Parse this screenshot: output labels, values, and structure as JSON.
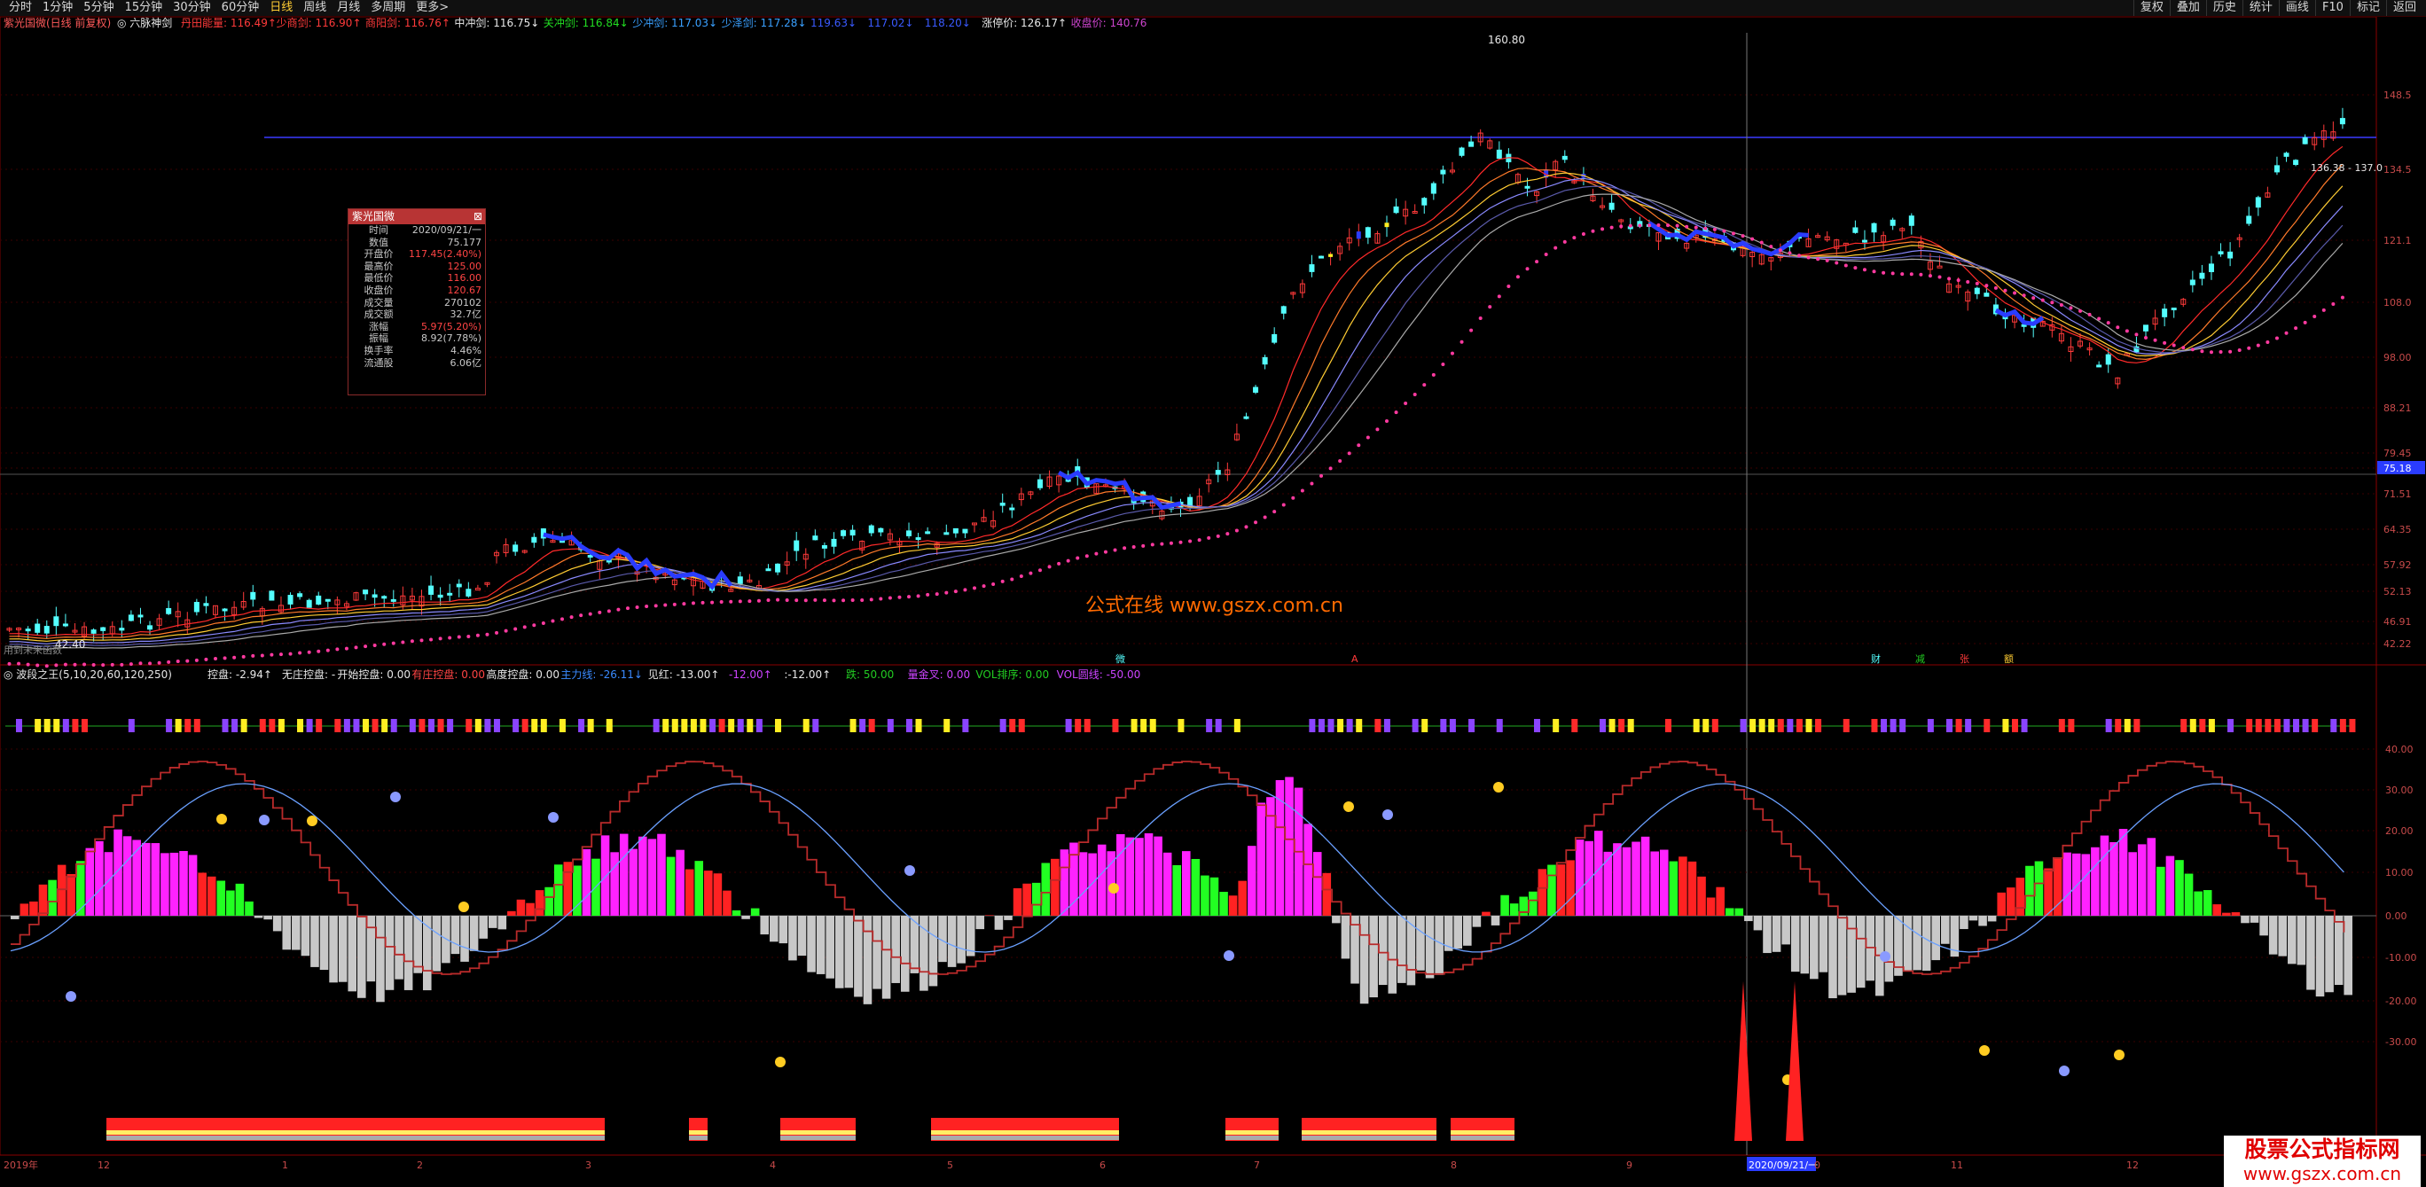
{
  "toolbar": {
    "periods": [
      "分时",
      "1分钟",
      "5分钟",
      "15分钟",
      "30分钟",
      "60分钟",
      "日线",
      "周线",
      "月线",
      "多周期",
      "更多>"
    ],
    "active_period": "日线",
    "right_buttons": [
      "复权",
      "叠加",
      "历史",
      "统计",
      "画线",
      "F10",
      "标记",
      "返回"
    ]
  },
  "main_header": {
    "stock": "紫光国微(日线 前复权)",
    "indicator": "◎ 六脉神剑",
    "items": [
      {
        "label": "丹田能量: 116.49↑",
        "color": "#ff3a3a"
      },
      {
        "label": "少商剑: 116.90↑",
        "color": "#ff3a3a"
      },
      {
        "label": "商阳剑: 116.76↑",
        "color": "#ff3a3a"
      },
      {
        "label": "中冲剑: 116.75↓",
        "color": "#e8e8e8"
      },
      {
        "label": "关冲剑: 116.84↓",
        "color": "#22dd22"
      },
      {
        "label": "少冲剑: 117.03↓",
        "color": "#3aa0ff"
      },
      {
        "label": "少泽剑: 117.28↓",
        "color": "#3aa0ff"
      },
      {
        "label": "119.63↓",
        "color": "#3a5aff"
      },
      {
        "label": "117.02↓",
        "color": "#3a5aff"
      },
      {
        "label": "118.20↓",
        "color": "#3a5aff"
      },
      {
        "label": "涨停价: 126.17↑",
        "color": "#e8e8e8"
      },
      {
        "label": "收盘价: 140.76",
        "color": "#cc44cc"
      }
    ]
  },
  "price_axis": [
    "148.5",
    "134.5",
    "121.1",
    "108.0",
    "98.00",
    "88.21",
    "79.45",
    "75.18",
    "71.51",
    "64.35",
    "57.92",
    "52.13",
    "46.91",
    "42.22"
  ],
  "price_marks": {
    "high": "160.80",
    "low": "42.40",
    "hover": "75.18",
    "right_label": "136.38 - 137.0"
  },
  "annotations": {
    "bottom_left": "用到未来函数",
    "center_markers": [
      "微",
      "A"
    ],
    "right_markers": [
      "财",
      "减",
      "张",
      "额"
    ]
  },
  "sub_header": {
    "name": "◎ 波段之王(5,10,20,60,120,250)",
    "items": [
      {
        "label": "控盘: -2.94↑",
        "color": "#e8e8e8"
      },
      {
        "label": "无庄控盘: -",
        "color": "#e8e8e8"
      },
      {
        "label": "开始控盘: 0.00",
        "color": "#e8e8e8"
      },
      {
        "label": "有庄控盘: 0.00",
        "color": "#ff4444"
      },
      {
        "label": "高度控盘: 0.00",
        "color": "#e8e8e8"
      },
      {
        "label": "主力线: -26.11↓",
        "color": "#3a8aff"
      },
      {
        "label": "见红: -13.00↑",
        "color": "#e8e8e8"
      },
      {
        "label": "-12.00↑",
        "color": "#cc44ff"
      },
      {
        "label": ":-12.00↑",
        "color": "#e8e8e8"
      },
      {
        "label": "跌: 50.00",
        "color": "#22cc22"
      },
      {
        "label": "量金叉: 0.00",
        "color": "#cc44ff"
      },
      {
        "label": "VOL排序: 0.00",
        "color": "#22cc22"
      },
      {
        "label": "VOL圆线: -50.00",
        "color": "#cc44ff"
      }
    ]
  },
  "sub_axis": [
    "40.00",
    "30.00",
    "20.00",
    "10.00",
    "0.00",
    "-10.00",
    "-20.00",
    "-30.00"
  ],
  "date_axis": [
    "2019年",
    "12",
    "1",
    "2",
    "3",
    "4",
    "5",
    "6",
    "7",
    "8",
    "9",
    "2020/09/21/一",
    "0",
    "11",
    "12"
  ],
  "popup": {
    "title": "紫光国微",
    "rows": [
      {
        "l": "时间",
        "v": "2020/09/21/一",
        "c": ""
      },
      {
        "l": "数值",
        "v": "75.177",
        "c": ""
      },
      {
        "l": "开盘价",
        "v": "117.45(2.40%)",
        "c": "r"
      },
      {
        "l": "最高价",
        "v": "125.00",
        "c": "r"
      },
      {
        "l": "最低价",
        "v": "116.00",
        "c": "r"
      },
      {
        "l": "收盘价",
        "v": "120.67",
        "c": "r"
      },
      {
        "l": "成交量",
        "v": "270102",
        "c": ""
      },
      {
        "l": "成交额",
        "v": "32.7亿",
        "c": ""
      },
      {
        "l": "涨幅",
        "v": "5.97(5.20%)",
        "c": "r"
      },
      {
        "l": "振幅",
        "v": "8.92(7.78%)",
        "c": ""
      },
      {
        "l": "换手率",
        "v": "4.46%",
        "c": ""
      },
      {
        "l": "流通股",
        "v": "6.06亿",
        "c": ""
      }
    ]
  },
  "watermark": "公式在线 www.gszx.com.cn",
  "watermark2": {
    "a": "股票公式指标网",
    "b": "www.gszx.com.cn"
  },
  "colors": {
    "up": "#ff3a3a",
    "down": "#54ffff",
    "grid": "#5a0000",
    "ma": "#ff3a3a",
    "dots": "#ff3aa0"
  }
}
